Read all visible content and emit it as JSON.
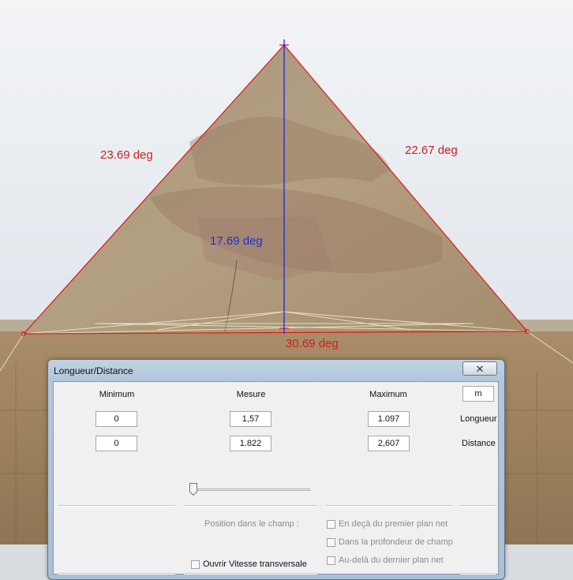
{
  "measurements": {
    "left_angle": "23.69 deg",
    "right_angle": "22.67 deg",
    "vertical_angle": "17.69 deg",
    "base_angle": "30.69 deg"
  },
  "dialog": {
    "title": "Longueur/Distance",
    "close_icon": "close-icon",
    "headers": {
      "minimum": "Minimum",
      "mesure": "Mesure",
      "maximum": "Maximum"
    },
    "unit": "m",
    "rows": {
      "longueur": {
        "label": "Longueur",
        "minimum": "0",
        "mesure": "1,57",
        "maximum": "1.097"
      },
      "distance": {
        "label": "Distance",
        "minimum": "0",
        "mesure": "1.822",
        "maximum": "2,607"
      }
    },
    "slider_value": 0,
    "position_label": "Position dans le champ :",
    "options": {
      "before": "En deçà du premier plan net",
      "within": "Dans la profondeur de champ",
      "beyond": "Au-delà du dernier plan net"
    },
    "open_transversal": "Ouvrir Vitesse transversale"
  },
  "colors": {
    "angle_red": "#cc1f1f",
    "angle_blue": "#1f2fd0"
  }
}
